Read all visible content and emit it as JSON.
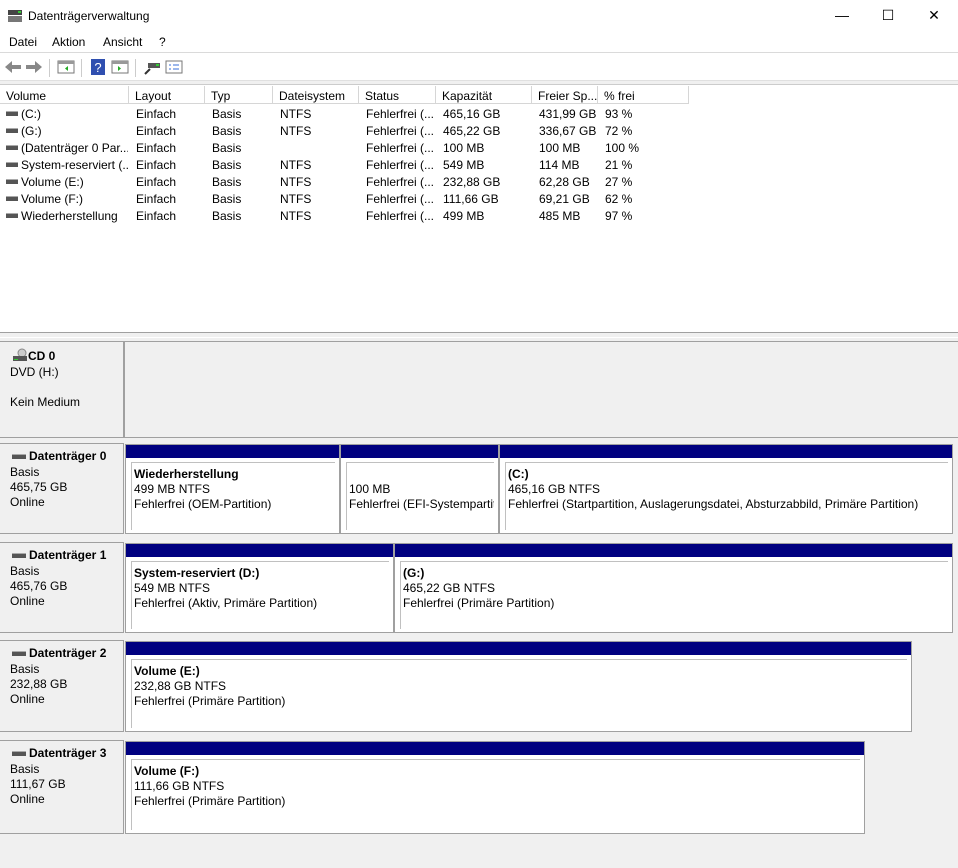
{
  "window": {
    "title": "Datenträgerverwaltung",
    "minimize": "—",
    "maximize": "☐",
    "close": "✕"
  },
  "menu": [
    "Datei",
    "Aktion",
    "Ansicht",
    "?"
  ],
  "toolbar": [
    "back-icon",
    "forward-icon",
    "console-tree-icon",
    "help-icon",
    "action-pane-icon",
    "connect-icon",
    "properties-icon"
  ],
  "list": {
    "columns": [
      "Volume",
      "Layout",
      "Typ",
      "Dateisystem",
      "Status",
      "Kapazität",
      "Freier Sp...",
      "% frei"
    ],
    "rows": [
      [
        "(C:)",
        "Einfach",
        "Basis",
        "NTFS",
        "Fehlerfrei (...",
        "465,16 GB",
        "431,99 GB",
        "93 %"
      ],
      [
        "(G:)",
        "Einfach",
        "Basis",
        "NTFS",
        "Fehlerfrei (...",
        "465,22 GB",
        "336,67 GB",
        "72 %"
      ],
      [
        "(Datenträger 0 Par...",
        "Einfach",
        "Basis",
        "",
        "Fehlerfrei (...",
        "100 MB",
        "100 MB",
        "100 %"
      ],
      [
        "System-reserviert (...",
        "Einfach",
        "Basis",
        "NTFS",
        "Fehlerfrei (...",
        "549 MB",
        "114 MB",
        "21 %"
      ],
      [
        "Volume (E:)",
        "Einfach",
        "Basis",
        "NTFS",
        "Fehlerfrei (...",
        "232,88 GB",
        "62,28 GB",
        "27 %"
      ],
      [
        "Volume (F:)",
        "Einfach",
        "Basis",
        "NTFS",
        "Fehlerfrei (...",
        "111,66 GB",
        "69,21 GB",
        "62 %"
      ],
      [
        "Wiederherstellung",
        "Einfach",
        "Basis",
        "NTFS",
        "Fehlerfrei (...",
        "499 MB",
        "485 MB",
        "97 %"
      ]
    ]
  },
  "cd": {
    "name": "CD 0",
    "type": "DVD (H:)",
    "status": "Kein Medium"
  },
  "disks": [
    {
      "name": "Datenträger 0",
      "type": "Basis",
      "size": "465,75 GB",
      "status": "Online",
      "partitions": [
        {
          "title": "Wiederherstellung",
          "size": "499 MB NTFS",
          "status": "Fehlerfrei (OEM-Partition)"
        },
        {
          "title": "",
          "size": "100 MB",
          "status": "Fehlerfrei (EFI-Systempartition)"
        },
        {
          "title": "(C:)",
          "size": "465,16 GB NTFS",
          "status": "Fehlerfrei (Startpartition, Auslagerungsdatei, Absturzabbild, Primäre Partition)"
        }
      ]
    },
    {
      "name": "Datenträger 1",
      "type": "Basis",
      "size": "465,76 GB",
      "status": "Online",
      "partitions": [
        {
          "title": "System-reserviert  (D:)",
          "size": "549 MB NTFS",
          "status": "Fehlerfrei (Aktiv, Primäre Partition)"
        },
        {
          "title": "(G:)",
          "size": "465,22 GB NTFS",
          "status": "Fehlerfrei (Primäre Partition)"
        }
      ]
    },
    {
      "name": "Datenträger 2",
      "type": "Basis",
      "size": "232,88 GB",
      "status": "Online",
      "partitions": [
        {
          "title": "Volume  (E:)",
          "size": "232,88 GB NTFS",
          "status": "Fehlerfrei (Primäre Partition)"
        }
      ]
    },
    {
      "name": "Datenträger 3",
      "type": "Basis",
      "size": "111,67 GB",
      "status": "Online",
      "partitions": [
        {
          "title": "Volume  (F:)",
          "size": "111,66 GB NTFS",
          "status": "Fehlerfrei (Primäre Partition)"
        }
      ]
    }
  ],
  "colors": {
    "partition_bar": "#000080"
  }
}
